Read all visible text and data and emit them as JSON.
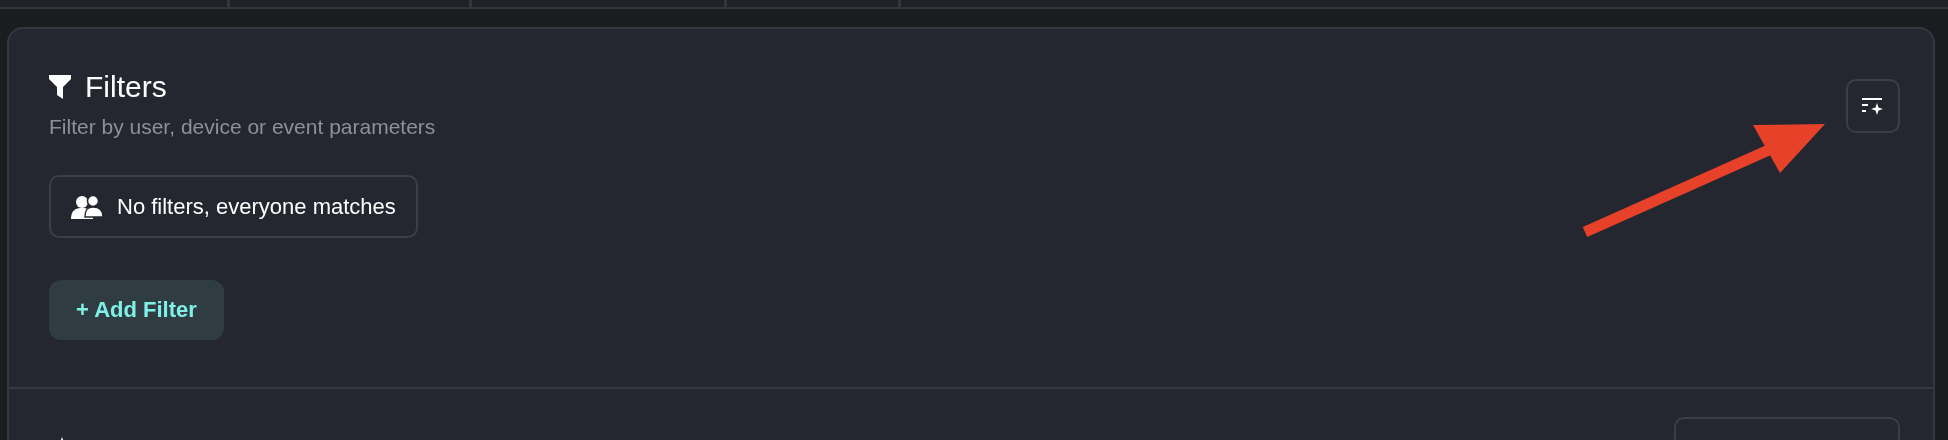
{
  "filters": {
    "title": "Filters",
    "subtitle": "Filter by user, device or event parameters",
    "status_chip": "No filters, everyone matches",
    "add_button": "+ Add Filter"
  },
  "annotation": {
    "kind": "arrow",
    "color": "#e8412a"
  }
}
